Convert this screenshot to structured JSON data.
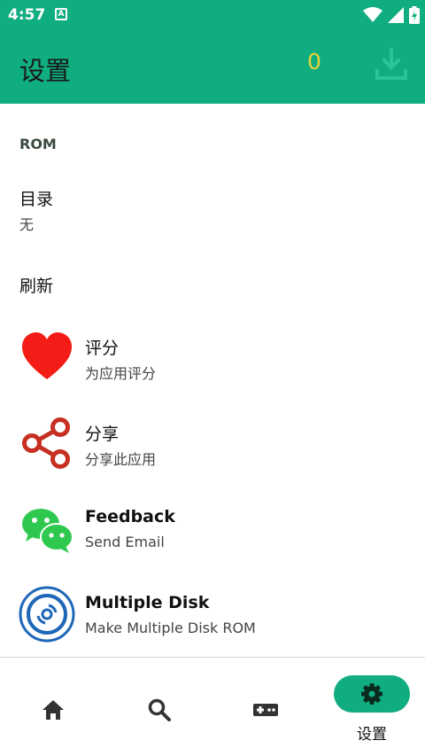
{
  "status_bar": {
    "time": "4:57",
    "notification_letter": "A"
  },
  "app_bar": {
    "title": "设置",
    "download_count": "0"
  },
  "sections": {
    "rom_header": "ROM"
  },
  "items": {
    "directory": {
      "title": "目录",
      "subtitle": "无"
    },
    "refresh": {
      "title": "刷新"
    },
    "rate": {
      "title": "评分",
      "subtitle": "为应用评分"
    },
    "share": {
      "title": "分享",
      "subtitle": "分享此应用"
    },
    "feedback": {
      "title": "Feedback",
      "subtitle": "Send Email"
    },
    "multiple_disk": {
      "title": "Multiple Disk",
      "subtitle": "Make Multiple Disk ROM"
    }
  },
  "bottom_nav": {
    "items": [
      {
        "icon": "home-icon"
      },
      {
        "icon": "search-icon"
      },
      {
        "icon": "gamepad-icon"
      },
      {
        "icon": "gear-icon",
        "label": "设置",
        "selected": true
      }
    ]
  },
  "colors": {
    "accent": "#0fad7f",
    "count_yellow": "#e8d23a",
    "heart_red": "#f41c16",
    "share_red": "#c62f21",
    "wechat_green": "#2dc84d",
    "disk_blue": "#1f67b8"
  }
}
